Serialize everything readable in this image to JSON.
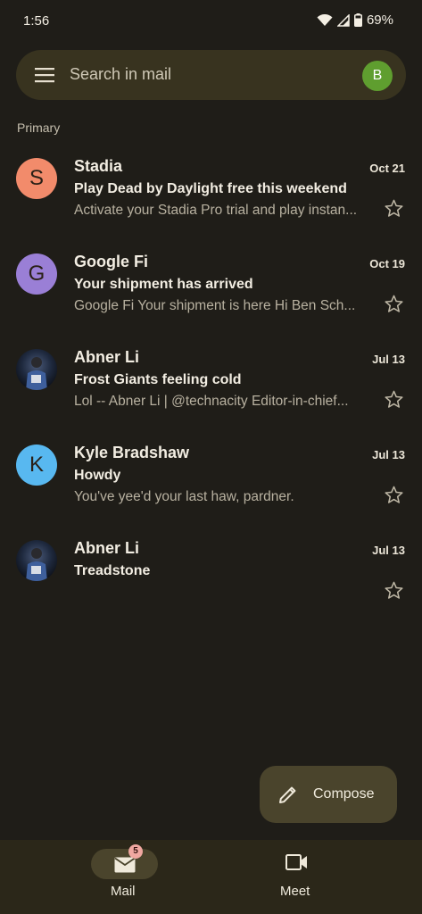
{
  "status_bar": {
    "time": "1:56",
    "battery": "69%"
  },
  "search": {
    "placeholder": "Search in mail",
    "account_initial": "B"
  },
  "section": "Primary",
  "emails": [
    {
      "sender": "Stadia",
      "initial": "S",
      "avatar_color": "#f28b6b",
      "date": "Oct 21",
      "subject": "Play Dead by Daylight free this weekend",
      "snippet": "Activate your Stadia Pro trial and play instan..."
    },
    {
      "sender": "Google Fi",
      "initial": "G",
      "avatar_color": "#9a7fd6",
      "date": "Oct 19",
      "subject": "Your shipment has arrived",
      "snippet": "Google Fi Your shipment is here Hi Ben Sch..."
    },
    {
      "sender": "Abner Li",
      "initial": "",
      "avatar_color": "photo",
      "date": "Jul 13",
      "subject": "Frost Giants feeling cold",
      "snippet": "Lol -- Abner Li | @technacity Editor-in-chief..."
    },
    {
      "sender": "Kyle Bradshaw",
      "initial": "K",
      "avatar_color": "#58b8f0",
      "date": "Jul 13",
      "subject": "Howdy",
      "snippet": "You've yee'd your last haw, pardner."
    },
    {
      "sender": "Abner Li",
      "initial": "",
      "avatar_color": "photo",
      "date": "Jul 13",
      "subject": "Treadstone",
      "snippet": ""
    }
  ],
  "compose": {
    "label": "Compose"
  },
  "nav": {
    "mail": "Mail",
    "mail_badge": "5",
    "meet": "Meet"
  }
}
